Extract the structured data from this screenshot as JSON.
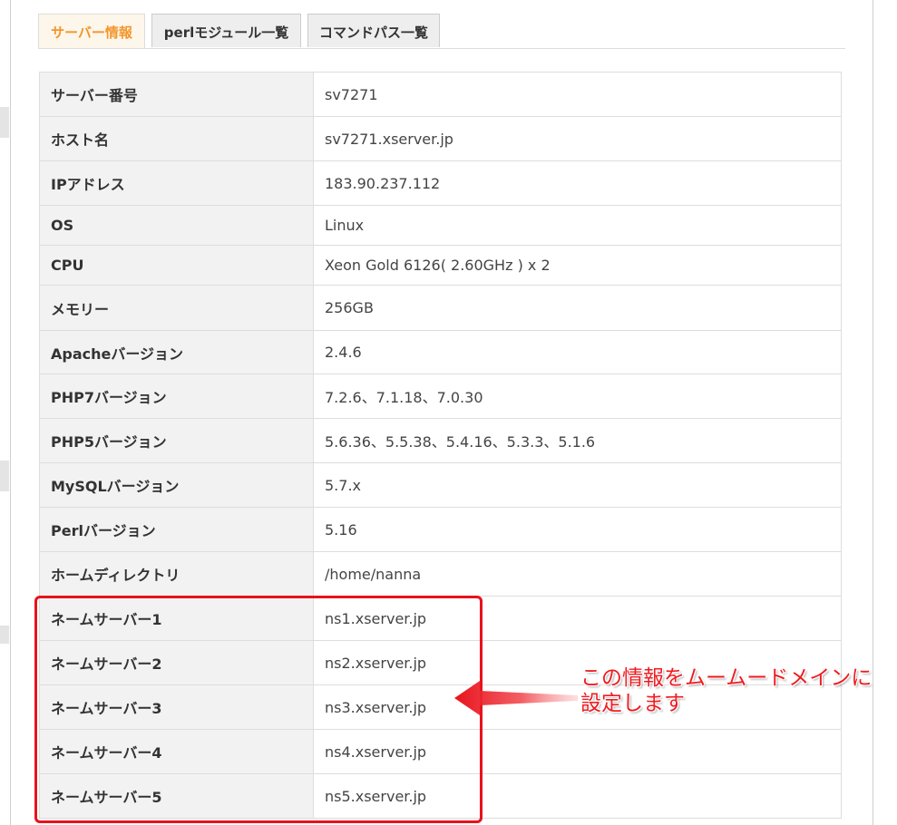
{
  "tabs": [
    {
      "label": "サーバー情報",
      "active": true
    },
    {
      "label": "perlモジュール一覧",
      "active": false
    },
    {
      "label": "コマンドパス一覧",
      "active": false
    }
  ],
  "rows": [
    {
      "key": "サーバー番号",
      "value": "sv7271"
    },
    {
      "key": "ホスト名",
      "value": "sv7271.xserver.jp"
    },
    {
      "key": "IPアドレス",
      "value": "183.90.237.112"
    },
    {
      "key": "OS",
      "value": "Linux"
    },
    {
      "key": "CPU",
      "value": "Xeon Gold 6126( 2.60GHz ) x 2"
    },
    {
      "key": "メモリー",
      "value": "256GB"
    },
    {
      "key": "Apacheバージョン",
      "value": "2.4.6"
    },
    {
      "key": "PHP7バージョン",
      "value": "7.2.6、7.1.18、7.0.30"
    },
    {
      "key": "PHP5バージョン",
      "value": "5.6.36、5.5.38、5.4.16、5.3.3、5.1.6"
    },
    {
      "key": "MySQLバージョン",
      "value": "5.7.x"
    },
    {
      "key": "Perlバージョン",
      "value": "5.16"
    },
    {
      "key": "ホームディレクトリ",
      "value": "/home/nanna"
    },
    {
      "key": "ネームサーバー1",
      "value": "ns1.xserver.jp"
    },
    {
      "key": "ネームサーバー2",
      "value": "ns2.xserver.jp"
    },
    {
      "key": "ネームサーバー3",
      "value": "ns3.xserver.jp"
    },
    {
      "key": "ネームサーバー4",
      "value": "ns4.xserver.jp"
    },
    {
      "key": "ネームサーバー5",
      "value": "ns5.xserver.jp"
    }
  ],
  "annotation": {
    "line1": "この情報をムームードメインに",
    "line2": "設定します"
  },
  "colors": {
    "active_tab_text": "#f3962c",
    "highlight": "#e8121b",
    "annotation_text": "#ee1c22"
  }
}
